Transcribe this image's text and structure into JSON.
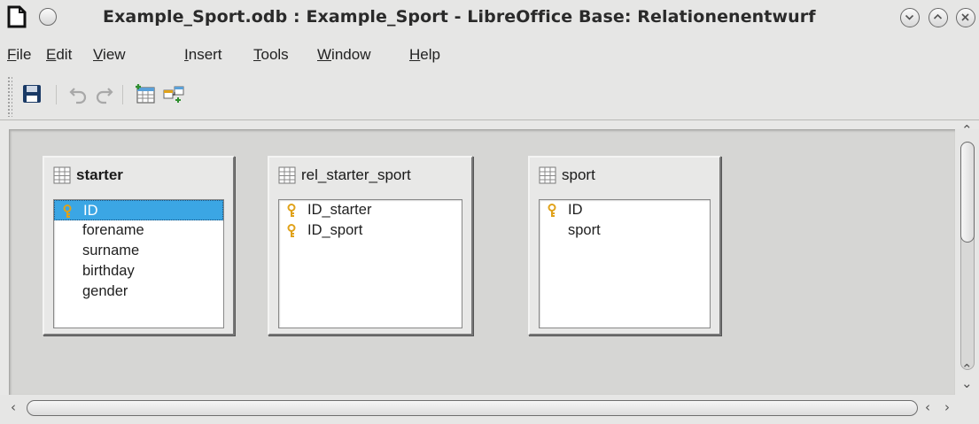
{
  "window": {
    "title": "Example_Sport.odb : Example_Sport - LibreOffice Base: Relationenentwurf"
  },
  "menu": {
    "file": {
      "acc": "F",
      "rest": "ile"
    },
    "edit": {
      "acc": "E",
      "rest": "dit"
    },
    "view": {
      "acc": "V",
      "rest": "iew"
    },
    "insert": {
      "acc": "I",
      "rest": "nsert"
    },
    "tools": {
      "acc": "T",
      "rest": "ools"
    },
    "window": {
      "acc": "W",
      "rest": "indow"
    },
    "help": {
      "acc": "H",
      "rest": "elp"
    }
  },
  "toolbar": {
    "icons": [
      "save-icon",
      "undo-icon",
      "redo-icon",
      "add-tables-icon",
      "new-relation-icon"
    ]
  },
  "tables": [
    {
      "name": "starter",
      "fields": [
        {
          "name": "ID",
          "key": true
        },
        {
          "name": "forename",
          "key": false
        },
        {
          "name": "surname",
          "key": false
        },
        {
          "name": "birthday",
          "key": false
        },
        {
          "name": "gender",
          "key": false
        }
      ]
    },
    {
      "name": "rel_starter_sport",
      "fields": [
        {
          "name": "ID_starter",
          "key": true
        },
        {
          "name": "ID_sport",
          "key": true
        }
      ]
    },
    {
      "name": "sport",
      "fields": [
        {
          "name": "ID",
          "key": true
        },
        {
          "name": "sport",
          "key": false
        }
      ]
    }
  ],
  "colors": {
    "selection": "#3ba6e4",
    "key": "#e0a21a",
    "background": "#d6d6d4"
  }
}
